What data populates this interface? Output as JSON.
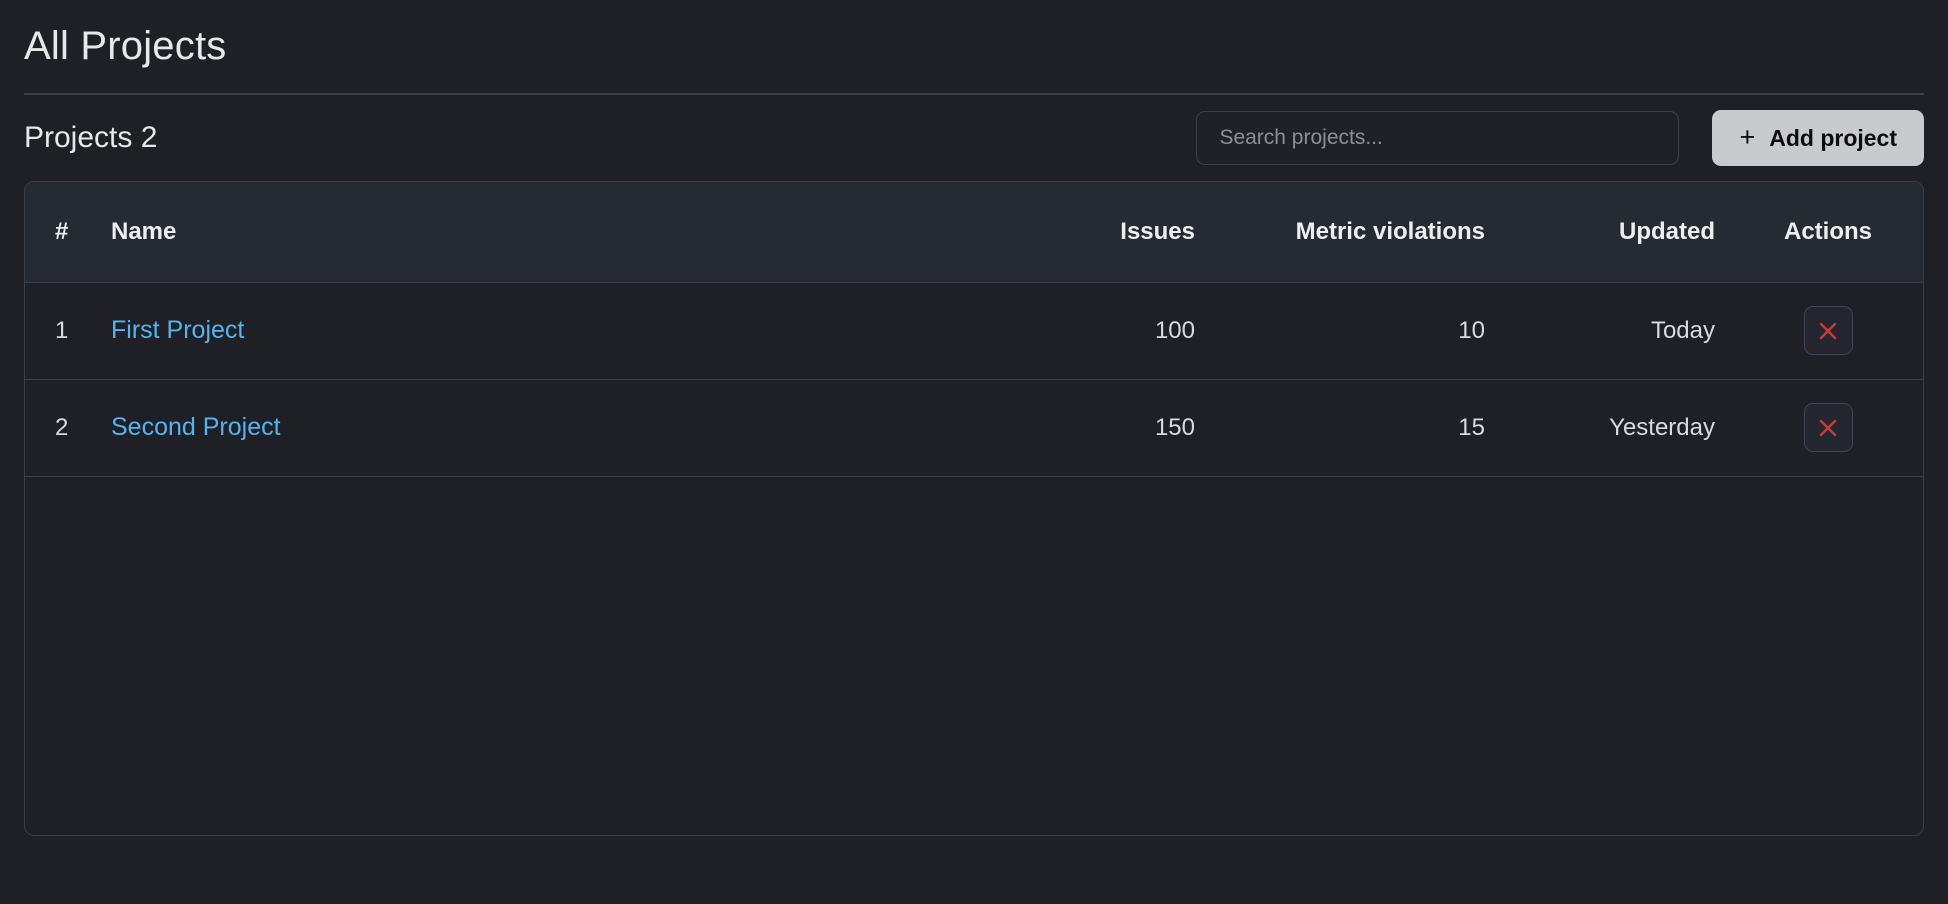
{
  "header": {
    "title": "All Projects"
  },
  "toolbar": {
    "section_title": "Projects 2",
    "search": {
      "placeholder": "Search projects...",
      "value": ""
    },
    "add_button": {
      "icon": "plus-icon",
      "plus_glyph": "+",
      "label": "Add project"
    }
  },
  "table": {
    "columns": [
      {
        "key": "index",
        "label": "#",
        "align": "left"
      },
      {
        "key": "name",
        "label": "Name",
        "align": "left"
      },
      {
        "key": "issues",
        "label": "Issues",
        "align": "right"
      },
      {
        "key": "metric_violations",
        "label": "Metric violations",
        "align": "right"
      },
      {
        "key": "updated",
        "label": "Updated",
        "align": "right"
      },
      {
        "key": "actions",
        "label": "Actions",
        "align": "center"
      }
    ],
    "rows": [
      {
        "index": "1",
        "name": "First Project",
        "issues": "100",
        "metric_violations": "10",
        "updated": "Today",
        "delete_icon": "close-icon"
      },
      {
        "index": "2",
        "name": "Second Project",
        "issues": "150",
        "metric_violations": "15",
        "updated": "Yesterday",
        "delete_icon": "close-icon"
      }
    ]
  },
  "colors": {
    "page_background": "#1e2025",
    "header_row_background": "#262a33",
    "border": "#3a3f47",
    "link": "#54b3f0",
    "danger": "#c83c38",
    "button_background": "#c9cace",
    "text_primary": "#e7e8ea"
  }
}
